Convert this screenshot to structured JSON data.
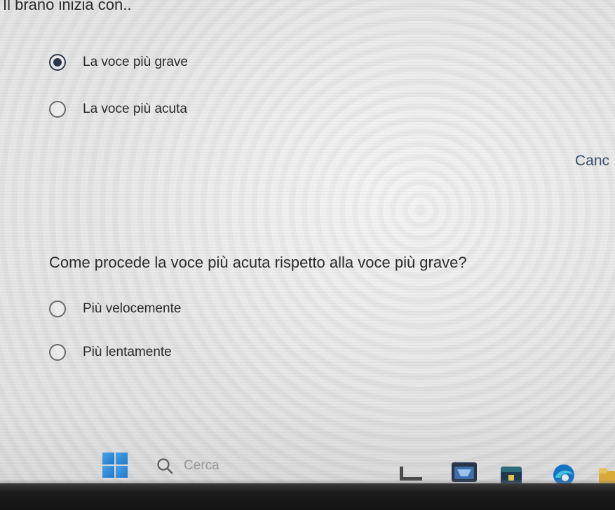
{
  "question1": {
    "title": "Il brano inizia con..",
    "options": [
      {
        "label": "La voce più grave",
        "selected": true
      },
      {
        "label": "La voce più acuta",
        "selected": false
      }
    ]
  },
  "cancel_label": "Canc",
  "question2": {
    "title": "Come procede la voce più acuta rispetto alla voce più grave?",
    "options": [
      {
        "label": "Più velocemente",
        "selected": false
      },
      {
        "label": "Più lentamente",
        "selected": false
      }
    ]
  },
  "taskbar": {
    "search_placeholder": "Cerca",
    "icons": [
      "windows-start-icon",
      "search-icon",
      "task-view-icon",
      "store-icon",
      "teams-icon",
      "edge-icon",
      "file-explorer-icon"
    ],
    "accent_color": "#1e77c9"
  }
}
